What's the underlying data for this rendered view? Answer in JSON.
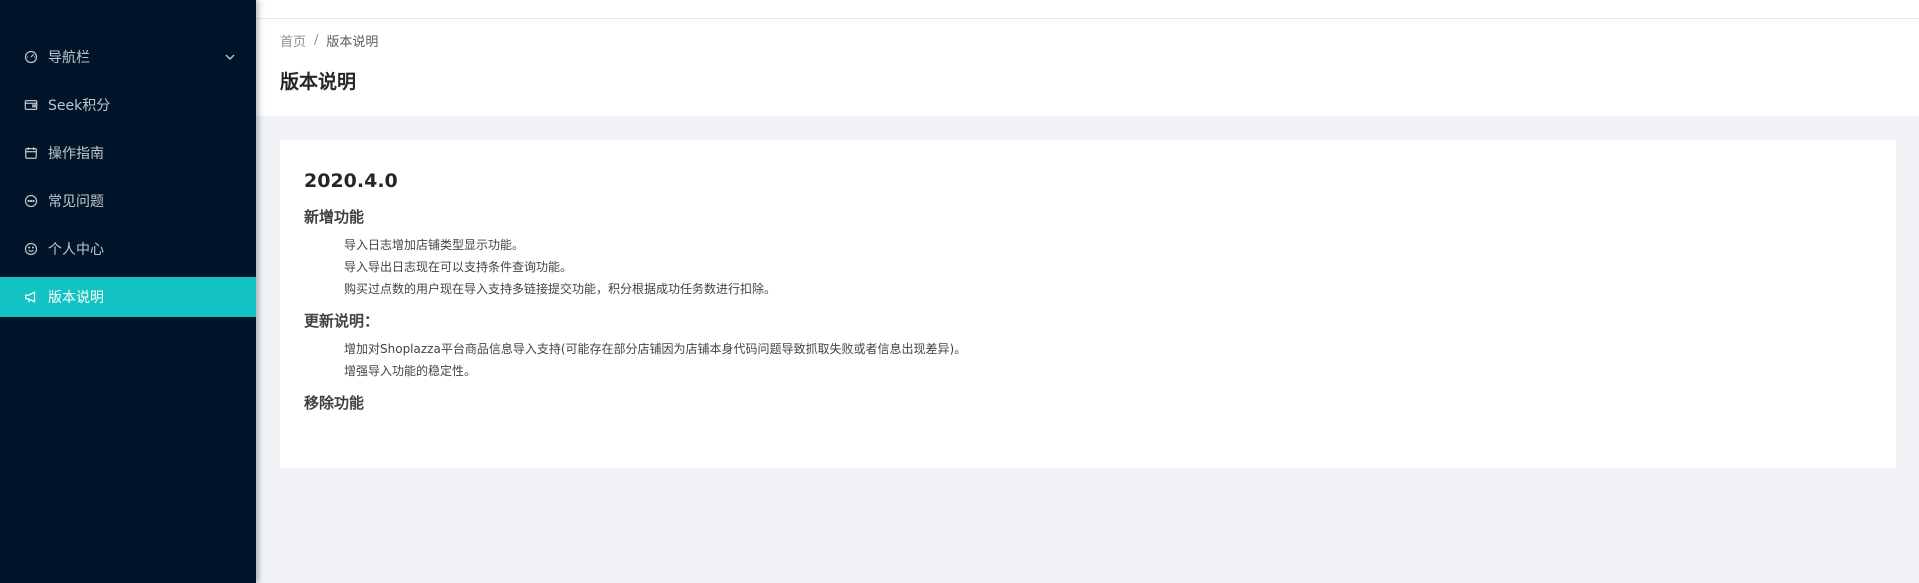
{
  "sidebar": {
    "items": [
      {
        "label": "导航栏",
        "icon": "dashboard-icon",
        "has_submenu": true,
        "active": false
      },
      {
        "label": "Seek积分",
        "icon": "wallet-icon",
        "has_submenu": false,
        "active": false
      },
      {
        "label": "操作指南",
        "icon": "calendar-icon",
        "has_submenu": false,
        "active": false
      },
      {
        "label": "常见问题",
        "icon": "message-icon",
        "has_submenu": false,
        "active": false
      },
      {
        "label": "个人中心",
        "icon": "smile-icon",
        "has_submenu": false,
        "active": false
      },
      {
        "label": "版本说明",
        "icon": "notification-icon",
        "has_submenu": false,
        "active": true
      }
    ],
    "accent_color": "#13c2c2",
    "background_color": "#001529"
  },
  "breadcrumb": {
    "home": "首页",
    "separator": "/",
    "current": "版本说明"
  },
  "page": {
    "title": "版本说明"
  },
  "release": {
    "version": "2020.4.0",
    "sections": [
      {
        "title": "新增功能",
        "items": [
          "导入日志增加店铺类型显示功能。",
          "导入导出日志现在可以支持条件查询功能。",
          "购买过点数的用户现在导入支持多链接提交功能，积分根据成功任务数进行扣除。"
        ]
      },
      {
        "title": "更新说明：",
        "items": [
          "增加对Shoplazza平台商品信息导入支持(可能存在部分店铺因为店铺本身代码问题导致抓取失败或者信息出现差异)。",
          "增强导入功能的稳定性。"
        ]
      },
      {
        "title": "移除功能",
        "items": []
      }
    ]
  }
}
